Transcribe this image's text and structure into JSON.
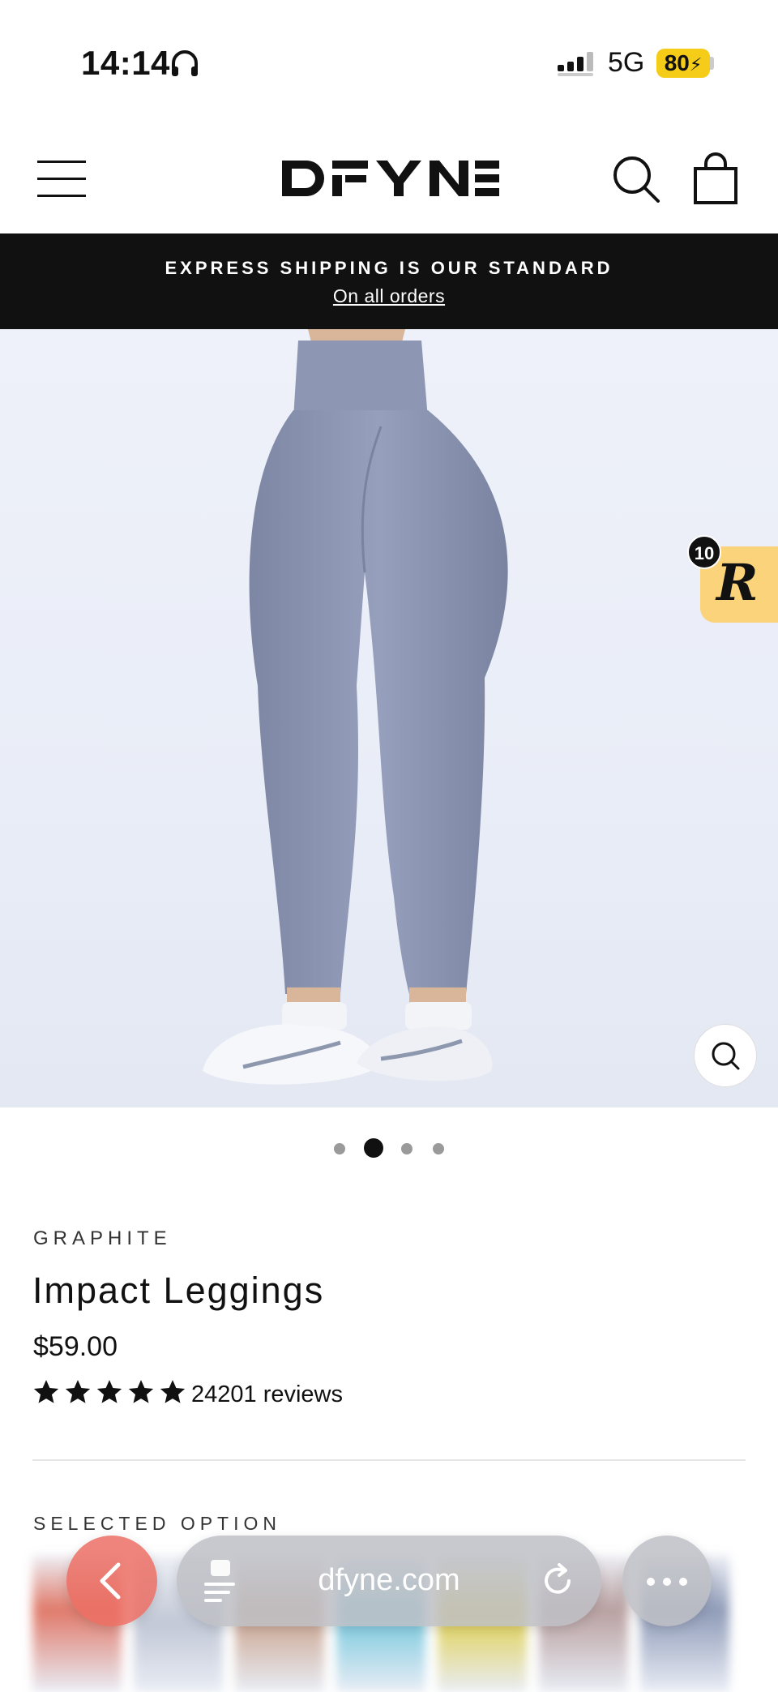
{
  "status_bar": {
    "time": "14:14",
    "network": "5G",
    "battery": "80"
  },
  "header": {
    "brand": "DFYNE",
    "cart_has_items": true
  },
  "announcement": {
    "title": "EXPRESS SHIPPING IS OUR STANDARD",
    "link": "On all orders"
  },
  "hero": {
    "image_alt": "Impact Leggings in Graphite",
    "rewards_count": "10",
    "rewards_letter": "R"
  },
  "carousel": {
    "total": 4,
    "active": 2
  },
  "product": {
    "variant": "GRAPHITE",
    "title": "Impact Leggings",
    "price": "$59.00",
    "rating": 5,
    "reviews": "24201 reviews",
    "selected_label": "SELECTED OPTION"
  },
  "browser": {
    "url": "dfyne.com"
  },
  "colors": {
    "accent": "#ef4a2a",
    "rewards": "#fbd37a",
    "announce_bg": "#111111",
    "legging": "#8791ad"
  }
}
